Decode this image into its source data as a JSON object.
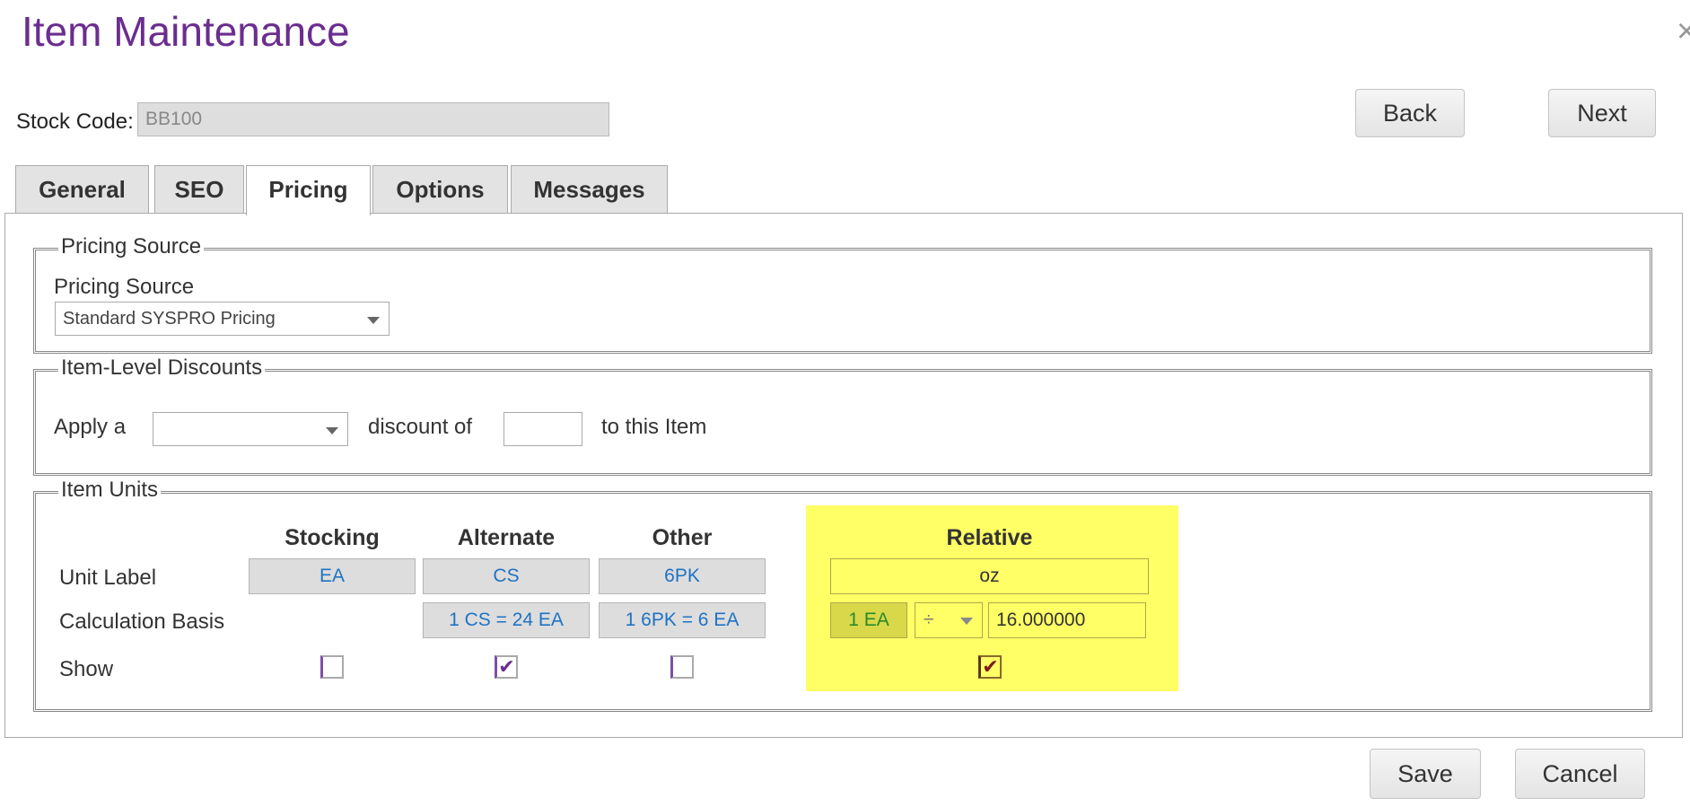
{
  "page": {
    "title": "Item Maintenance",
    "close_glyph": "×"
  },
  "stock": {
    "label": "Stock Code:",
    "value": "BB100"
  },
  "nav": {
    "back_label": "Back",
    "next_label": "Next"
  },
  "tabs": [
    {
      "label": "General",
      "active": false
    },
    {
      "label": "SEO",
      "active": false
    },
    {
      "label": "Pricing",
      "active": true
    },
    {
      "label": "Options",
      "active": false
    },
    {
      "label": "Messages",
      "active": false
    }
  ],
  "pricing_source": {
    "legend": "Pricing Source",
    "field_label": "Pricing Source",
    "selected": "Standard SYSPRO Pricing"
  },
  "discounts": {
    "legend": "Item-Level Discounts",
    "prefix": "Apply a",
    "type_selected": "",
    "middle": "discount of",
    "amount_value": "",
    "suffix": "to this Item"
  },
  "units": {
    "legend": "Item Units",
    "columns": {
      "stocking": "Stocking",
      "alternate": "Alternate",
      "other": "Other",
      "relative": "Relative"
    },
    "row_labels": {
      "unit_label": "Unit Label",
      "calculation_basis": "Calculation Basis",
      "show": "Show"
    },
    "stocking": {
      "unit": "EA",
      "show": false
    },
    "alternate": {
      "unit": "CS",
      "basis": "1 CS = 24 EA",
      "show": true
    },
    "other": {
      "unit": "6PK",
      "basis": "1 6PK = 6 EA",
      "show": false
    },
    "relative": {
      "unit": "oz",
      "base": "1 EA",
      "operator": "÷",
      "factor": "16.000000",
      "show": true
    },
    "check_glyph": "✔"
  },
  "footer": {
    "save_label": "Save",
    "cancel_label": "Cancel"
  },
  "colors": {
    "title": "#6b2d8f",
    "highlight": "#ffff66",
    "unit_text": "#1f73c4"
  }
}
